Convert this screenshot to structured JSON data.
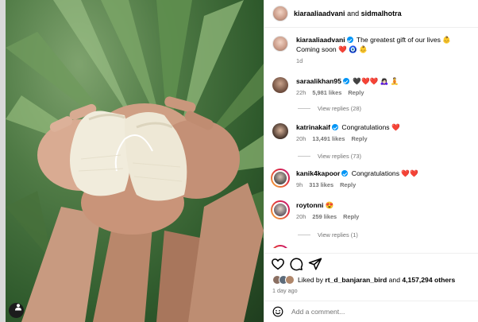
{
  "header": {
    "author": "kiaraaliaadvani",
    "joiner": "and",
    "coauthor": "sidmalhotra"
  },
  "caption": {
    "username": "kiaraaliaadvani",
    "text": "The greatest gift of our lives 👶",
    "line2": "Coming soon ❤️ 🧿 👶",
    "time": "1d"
  },
  "comments": [
    {
      "username": "saraalikhan95",
      "text": "🖤❤️❤️ 🙇🏻‍♀️ 🧘",
      "time": "22h",
      "likes": "5,981 likes",
      "reply": "Reply",
      "view_replies": "View replies (28)"
    },
    {
      "username": "katrinakaif",
      "text": "Congratulations ❤️",
      "time": "20h",
      "likes": "13,491 likes",
      "reply": "Reply",
      "view_replies": "View replies (73)"
    },
    {
      "username": "kanik4kapoor",
      "text": "Congratulations ❤️❤️",
      "time": "9h",
      "likes": "313 likes",
      "reply": "Reply"
    },
    {
      "username": "roytonni",
      "text": "😍",
      "time": "20h",
      "likes": "259 likes",
      "reply": "Reply",
      "view_replies": "View replies (1)"
    }
  ],
  "likes": {
    "prefix": "Liked by",
    "user": "rt_d_banjaran_bird",
    "joiner": "and",
    "others": "4,157,294 others"
  },
  "post_time": "1 day ago",
  "add_comment": {
    "placeholder": "Add a comment..."
  },
  "icons": [
    "heart-icon",
    "comment-icon",
    "share-icon",
    "emoji-icon",
    "user-tag-icon",
    "verified-badge"
  ],
  "colors": {
    "link_blue": "#0095f6",
    "heart_red": "#ed2c3c",
    "muted_text": "#737373",
    "border": "#efefef"
  }
}
